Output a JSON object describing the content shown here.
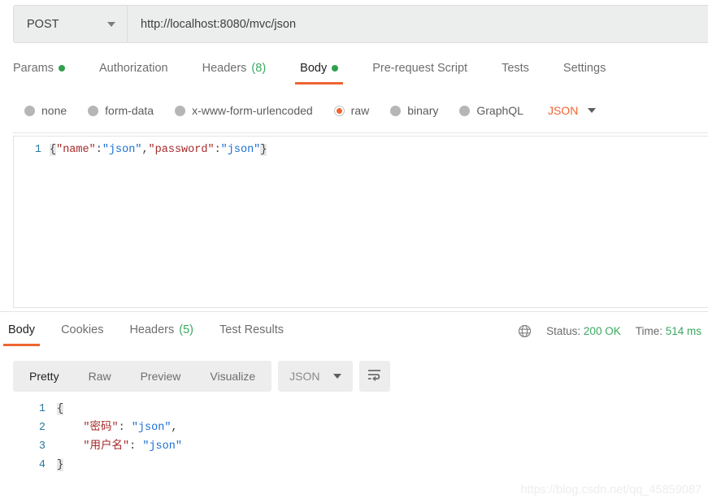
{
  "request": {
    "method": "POST",
    "method_caret": "chevron-down-icon",
    "url": "http://localhost:8080/mvc/json",
    "tabs": [
      {
        "label": "Params",
        "indicator": "dot",
        "active": false
      },
      {
        "label": "Authorization",
        "indicator": "",
        "active": false
      },
      {
        "label": "Headers",
        "count": "(8)",
        "indicator": "count",
        "active": false
      },
      {
        "label": "Body",
        "indicator": "dot",
        "active": true
      },
      {
        "label": "Pre-request Script",
        "indicator": "",
        "active": false
      },
      {
        "label": "Tests",
        "indicator": "",
        "active": false
      },
      {
        "label": "Settings",
        "indicator": "",
        "active": false
      }
    ],
    "body_types": [
      {
        "label": "none",
        "selected": false
      },
      {
        "label": "form-data",
        "selected": false
      },
      {
        "label": "x-www-form-urlencoded",
        "selected": false
      },
      {
        "label": "raw",
        "selected": true
      },
      {
        "label": "binary",
        "selected": false
      },
      {
        "label": "GraphQL",
        "selected": false
      }
    ],
    "format_select": {
      "value": "JSON",
      "caret": "chevron-down-icon"
    },
    "body_editor": {
      "lines": [
        {
          "number": "1",
          "tokens": [
            {
              "text": "{",
              "type": "brace"
            },
            {
              "text": "\"name\"",
              "type": "key"
            },
            {
              "text": ":",
              "type": "punc"
            },
            {
              "text": "\"json\"",
              "type": "str"
            },
            {
              "text": ",",
              "type": "punc"
            },
            {
              "text": "\"password\"",
              "type": "key"
            },
            {
              "text": ":",
              "type": "punc"
            },
            {
              "text": "\"json\"",
              "type": "str"
            },
            {
              "text": "}",
              "type": "brace"
            }
          ]
        }
      ]
    }
  },
  "response": {
    "tabs": [
      {
        "label": "Body",
        "indicator": "",
        "active": true
      },
      {
        "label": "Cookies",
        "indicator": "",
        "active": false
      },
      {
        "label": "Headers",
        "count": "(5)",
        "indicator": "count",
        "active": false
      },
      {
        "label": "Test Results",
        "indicator": "",
        "active": false
      }
    ],
    "meta": {
      "globe_icon": "globe-icon",
      "status_label": "Status:",
      "status_value": "200 OK",
      "time_label": "Time:",
      "time_value": "514 ms"
    },
    "view_modes": [
      {
        "label": "Pretty",
        "active": true
      },
      {
        "label": "Raw",
        "active": false
      },
      {
        "label": "Preview",
        "active": false
      },
      {
        "label": "Visualize",
        "active": false
      }
    ],
    "format_select": {
      "value": "JSON",
      "caret": "chevron-down-icon"
    },
    "wrap_button": "word-wrap-icon",
    "body_code": {
      "lines": [
        {
          "number": "1",
          "tokens": [
            {
              "text": "{",
              "type": "brace"
            }
          ]
        },
        {
          "number": "2",
          "tokens": [
            {
              "text": "    ",
              "type": "punc"
            },
            {
              "text": "\"密码\"",
              "type": "key"
            },
            {
              "text": ": ",
              "type": "punc"
            },
            {
              "text": "\"json\"",
              "type": "str"
            },
            {
              "text": ",",
              "type": "punc"
            }
          ]
        },
        {
          "number": "3",
          "tokens": [
            {
              "text": "    ",
              "type": "punc"
            },
            {
              "text": "\"用户名\"",
              "type": "key"
            },
            {
              "text": ": ",
              "type": "punc"
            },
            {
              "text": "\"json\"",
              "type": "str"
            }
          ]
        },
        {
          "number": "4",
          "tokens": [
            {
              "text": "}",
              "type": "brace"
            }
          ]
        }
      ]
    }
  },
  "watermark": {
    "text": "https://blog.csdn.net/qq_45859087"
  },
  "colors": {
    "accent_orange": "#ef6533",
    "success_green": "#3aa860",
    "dot_green": "#2ea14d",
    "key_red": "#a52a2a",
    "string_blue": "#1a6fd4",
    "gutter_blue": "#2b7a9e"
  }
}
